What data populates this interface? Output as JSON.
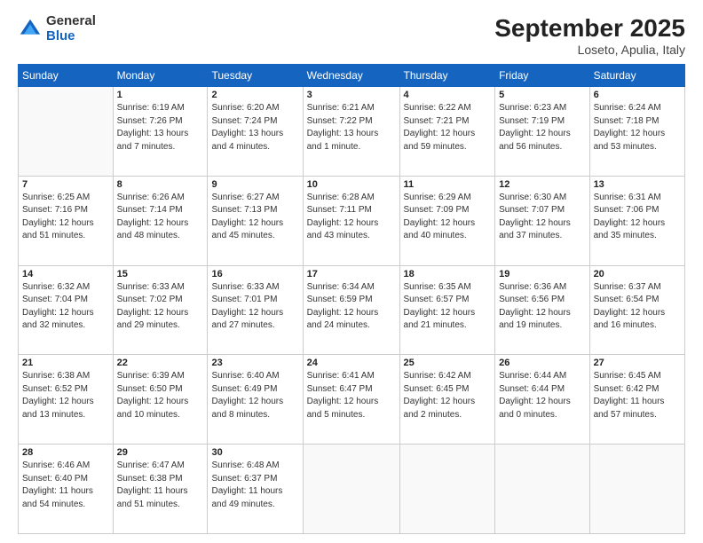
{
  "logo": {
    "general": "General",
    "blue": "Blue"
  },
  "title": "September 2025",
  "subtitle": "Loseto, Apulia, Italy",
  "days": [
    "Sunday",
    "Monday",
    "Tuesday",
    "Wednesday",
    "Thursday",
    "Friday",
    "Saturday"
  ],
  "weeks": [
    [
      {
        "date": "",
        "sunrise": "",
        "sunset": "",
        "daylight": ""
      },
      {
        "date": "1",
        "sunrise": "Sunrise: 6:19 AM",
        "sunset": "Sunset: 7:26 PM",
        "daylight": "Daylight: 13 hours and 7 minutes."
      },
      {
        "date": "2",
        "sunrise": "Sunrise: 6:20 AM",
        "sunset": "Sunset: 7:24 PM",
        "daylight": "Daylight: 13 hours and 4 minutes."
      },
      {
        "date": "3",
        "sunrise": "Sunrise: 6:21 AM",
        "sunset": "Sunset: 7:22 PM",
        "daylight": "Daylight: 13 hours and 1 minute."
      },
      {
        "date": "4",
        "sunrise": "Sunrise: 6:22 AM",
        "sunset": "Sunset: 7:21 PM",
        "daylight": "Daylight: 12 hours and 59 minutes."
      },
      {
        "date": "5",
        "sunrise": "Sunrise: 6:23 AM",
        "sunset": "Sunset: 7:19 PM",
        "daylight": "Daylight: 12 hours and 56 minutes."
      },
      {
        "date": "6",
        "sunrise": "Sunrise: 6:24 AM",
        "sunset": "Sunset: 7:18 PM",
        "daylight": "Daylight: 12 hours and 53 minutes."
      }
    ],
    [
      {
        "date": "7",
        "sunrise": "Sunrise: 6:25 AM",
        "sunset": "Sunset: 7:16 PM",
        "daylight": "Daylight: 12 hours and 51 minutes."
      },
      {
        "date": "8",
        "sunrise": "Sunrise: 6:26 AM",
        "sunset": "Sunset: 7:14 PM",
        "daylight": "Daylight: 12 hours and 48 minutes."
      },
      {
        "date": "9",
        "sunrise": "Sunrise: 6:27 AM",
        "sunset": "Sunset: 7:13 PM",
        "daylight": "Daylight: 12 hours and 45 minutes."
      },
      {
        "date": "10",
        "sunrise": "Sunrise: 6:28 AM",
        "sunset": "Sunset: 7:11 PM",
        "daylight": "Daylight: 12 hours and 43 minutes."
      },
      {
        "date": "11",
        "sunrise": "Sunrise: 6:29 AM",
        "sunset": "Sunset: 7:09 PM",
        "daylight": "Daylight: 12 hours and 40 minutes."
      },
      {
        "date": "12",
        "sunrise": "Sunrise: 6:30 AM",
        "sunset": "Sunset: 7:07 PM",
        "daylight": "Daylight: 12 hours and 37 minutes."
      },
      {
        "date": "13",
        "sunrise": "Sunrise: 6:31 AM",
        "sunset": "Sunset: 7:06 PM",
        "daylight": "Daylight: 12 hours and 35 minutes."
      }
    ],
    [
      {
        "date": "14",
        "sunrise": "Sunrise: 6:32 AM",
        "sunset": "Sunset: 7:04 PM",
        "daylight": "Daylight: 12 hours and 32 minutes."
      },
      {
        "date": "15",
        "sunrise": "Sunrise: 6:33 AM",
        "sunset": "Sunset: 7:02 PM",
        "daylight": "Daylight: 12 hours and 29 minutes."
      },
      {
        "date": "16",
        "sunrise": "Sunrise: 6:33 AM",
        "sunset": "Sunset: 7:01 PM",
        "daylight": "Daylight: 12 hours and 27 minutes."
      },
      {
        "date": "17",
        "sunrise": "Sunrise: 6:34 AM",
        "sunset": "Sunset: 6:59 PM",
        "daylight": "Daylight: 12 hours and 24 minutes."
      },
      {
        "date": "18",
        "sunrise": "Sunrise: 6:35 AM",
        "sunset": "Sunset: 6:57 PM",
        "daylight": "Daylight: 12 hours and 21 minutes."
      },
      {
        "date": "19",
        "sunrise": "Sunrise: 6:36 AM",
        "sunset": "Sunset: 6:56 PM",
        "daylight": "Daylight: 12 hours and 19 minutes."
      },
      {
        "date": "20",
        "sunrise": "Sunrise: 6:37 AM",
        "sunset": "Sunset: 6:54 PM",
        "daylight": "Daylight: 12 hours and 16 minutes."
      }
    ],
    [
      {
        "date": "21",
        "sunrise": "Sunrise: 6:38 AM",
        "sunset": "Sunset: 6:52 PM",
        "daylight": "Daylight: 12 hours and 13 minutes."
      },
      {
        "date": "22",
        "sunrise": "Sunrise: 6:39 AM",
        "sunset": "Sunset: 6:50 PM",
        "daylight": "Daylight: 12 hours and 10 minutes."
      },
      {
        "date": "23",
        "sunrise": "Sunrise: 6:40 AM",
        "sunset": "Sunset: 6:49 PM",
        "daylight": "Daylight: 12 hours and 8 minutes."
      },
      {
        "date": "24",
        "sunrise": "Sunrise: 6:41 AM",
        "sunset": "Sunset: 6:47 PM",
        "daylight": "Daylight: 12 hours and 5 minutes."
      },
      {
        "date": "25",
        "sunrise": "Sunrise: 6:42 AM",
        "sunset": "Sunset: 6:45 PM",
        "daylight": "Daylight: 12 hours and 2 minutes."
      },
      {
        "date": "26",
        "sunrise": "Sunrise: 6:44 AM",
        "sunset": "Sunset: 6:44 PM",
        "daylight": "Daylight: 12 hours and 0 minutes."
      },
      {
        "date": "27",
        "sunrise": "Sunrise: 6:45 AM",
        "sunset": "Sunset: 6:42 PM",
        "daylight": "Daylight: 11 hours and 57 minutes."
      }
    ],
    [
      {
        "date": "28",
        "sunrise": "Sunrise: 6:46 AM",
        "sunset": "Sunset: 6:40 PM",
        "daylight": "Daylight: 11 hours and 54 minutes."
      },
      {
        "date": "29",
        "sunrise": "Sunrise: 6:47 AM",
        "sunset": "Sunset: 6:38 PM",
        "daylight": "Daylight: 11 hours and 51 minutes."
      },
      {
        "date": "30",
        "sunrise": "Sunrise: 6:48 AM",
        "sunset": "Sunset: 6:37 PM",
        "daylight": "Daylight: 11 hours and 49 minutes."
      },
      {
        "date": "",
        "sunrise": "",
        "sunset": "",
        "daylight": ""
      },
      {
        "date": "",
        "sunrise": "",
        "sunset": "",
        "daylight": ""
      },
      {
        "date": "",
        "sunrise": "",
        "sunset": "",
        "daylight": ""
      },
      {
        "date": "",
        "sunrise": "",
        "sunset": "",
        "daylight": ""
      }
    ]
  ]
}
